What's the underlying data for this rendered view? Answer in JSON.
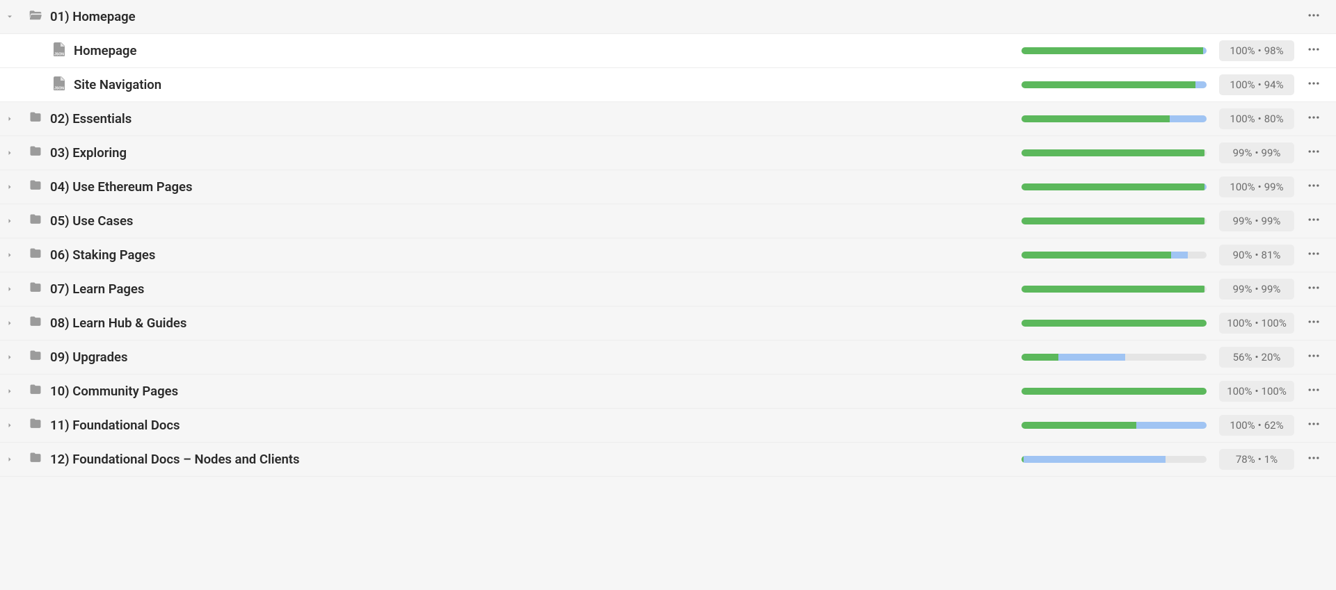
{
  "rows": [
    {
      "id": "r0",
      "kind": "folder",
      "level": 0,
      "expanded": true,
      "name": "01) Homepage",
      "progress": null,
      "stats": null
    },
    {
      "id": "r0a",
      "kind": "file",
      "level": 1,
      "expanded": null,
      "name": "Homepage",
      "progress": {
        "green": 98,
        "blue": 2
      },
      "stats": {
        "a": "100%",
        "b": "98%"
      }
    },
    {
      "id": "r0b",
      "kind": "file",
      "level": 1,
      "expanded": null,
      "name": "Site Navigation",
      "progress": {
        "green": 94,
        "blue": 6
      },
      "stats": {
        "a": "100%",
        "b": "94%"
      }
    },
    {
      "id": "r1",
      "kind": "folder",
      "level": 0,
      "expanded": false,
      "name": "02) Essentials",
      "progress": {
        "green": 80,
        "blue": 20
      },
      "stats": {
        "a": "100%",
        "b": "80%"
      }
    },
    {
      "id": "r2",
      "kind": "folder",
      "level": 0,
      "expanded": false,
      "name": "03) Exploring",
      "progress": {
        "green": 99,
        "blue": 0
      },
      "stats": {
        "a": "99%",
        "b": "99%"
      }
    },
    {
      "id": "r3",
      "kind": "folder",
      "level": 0,
      "expanded": false,
      "name": "04) Use Ethereum Pages",
      "progress": {
        "green": 99,
        "blue": 1
      },
      "stats": {
        "a": "100%",
        "b": "99%"
      }
    },
    {
      "id": "r4",
      "kind": "folder",
      "level": 0,
      "expanded": false,
      "name": "05) Use Cases",
      "progress": {
        "green": 99,
        "blue": 0
      },
      "stats": {
        "a": "99%",
        "b": "99%"
      }
    },
    {
      "id": "r5",
      "kind": "folder",
      "level": 0,
      "expanded": false,
      "name": "06) Staking Pages",
      "progress": {
        "green": 81,
        "blue": 9
      },
      "stats": {
        "a": "90%",
        "b": "81%"
      }
    },
    {
      "id": "r6",
      "kind": "folder",
      "level": 0,
      "expanded": false,
      "name": "07) Learn Pages",
      "progress": {
        "green": 99,
        "blue": 0
      },
      "stats": {
        "a": "99%",
        "b": "99%"
      }
    },
    {
      "id": "r7",
      "kind": "folder",
      "level": 0,
      "expanded": false,
      "name": "08) Learn Hub & Guides",
      "progress": {
        "green": 100,
        "blue": 0
      },
      "stats": {
        "a": "100%",
        "b": "100%"
      }
    },
    {
      "id": "r8",
      "kind": "folder",
      "level": 0,
      "expanded": false,
      "name": "09) Upgrades",
      "progress": {
        "green": 20,
        "blue": 36
      },
      "stats": {
        "a": "56%",
        "b": "20%"
      }
    },
    {
      "id": "r9",
      "kind": "folder",
      "level": 0,
      "expanded": false,
      "name": "10) Community Pages",
      "progress": {
        "green": 100,
        "blue": 0
      },
      "stats": {
        "a": "100%",
        "b": "100%"
      }
    },
    {
      "id": "r10",
      "kind": "folder",
      "level": 0,
      "expanded": false,
      "name": "11) Foundational Docs",
      "progress": {
        "green": 62,
        "blue": 38
      },
      "stats": {
        "a": "100%",
        "b": "62%"
      }
    },
    {
      "id": "r11",
      "kind": "folder",
      "level": 0,
      "expanded": false,
      "name": "12) Foundational Docs – Nodes and Clients",
      "progress": {
        "green": 1,
        "blue": 77
      },
      "stats": {
        "a": "78%",
        "b": "1%"
      }
    }
  ]
}
